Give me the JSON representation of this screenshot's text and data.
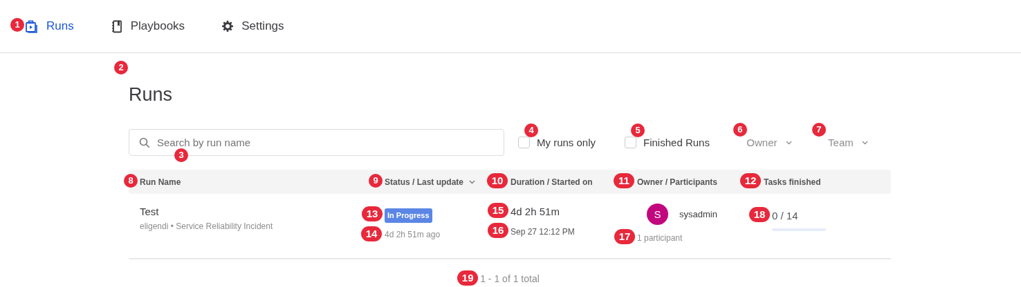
{
  "nav": {
    "tabs": [
      {
        "label": "Runs",
        "selected": true,
        "marker": "1"
      },
      {
        "label": "Playbooks",
        "selected": false
      },
      {
        "label": "Settings",
        "selected": false
      }
    ]
  },
  "title": {
    "text": "Runs",
    "marker": "2"
  },
  "search": {
    "placeholder": "Search by run name",
    "marker": "3"
  },
  "filters": [
    {
      "kind": "checkbox",
      "label": "My runs only",
      "checked": false,
      "marker": "4"
    },
    {
      "kind": "checkbox",
      "label": "Finished Runs",
      "checked": false,
      "marker": "5"
    },
    {
      "kind": "dropdown",
      "label": "Owner",
      "marker": "6"
    },
    {
      "kind": "dropdown",
      "label": "Team",
      "marker": "7"
    }
  ],
  "table": {
    "columns": [
      {
        "label": "Run Name",
        "sorted": false,
        "marker": "8"
      },
      {
        "label": "Status / Last update",
        "sorted": true,
        "marker": "9"
      },
      {
        "label": "Duration / Started on",
        "sorted": false,
        "marker": "10"
      },
      {
        "label": "Owner / Participants",
        "sorted": false,
        "marker": "11"
      },
      {
        "label": "Tasks finished",
        "sorted": false,
        "marker": "12"
      }
    ],
    "rows": [
      {
        "name": "Test",
        "subtitle": "eligendi • Service Reliability Incident",
        "status": {
          "text": "In Progress",
          "marker": "13"
        },
        "updated": {
          "text": "4d 2h 51m ago",
          "marker": "14"
        },
        "duration": {
          "text": "4d 2h 51m",
          "marker": "15"
        },
        "started": {
          "text": "Sep 27 12:12 PM",
          "marker": "16"
        },
        "owner": {
          "initial": "S",
          "name": "sysadmin"
        },
        "participants": {
          "text": "1 participant",
          "marker": "17"
        },
        "tasks": {
          "text": "0 / 14",
          "marker": "18",
          "level": 0
        }
      }
    ]
  },
  "pagination": {
    "text": "1 - 1 of 1 total",
    "marker": "19"
  }
}
